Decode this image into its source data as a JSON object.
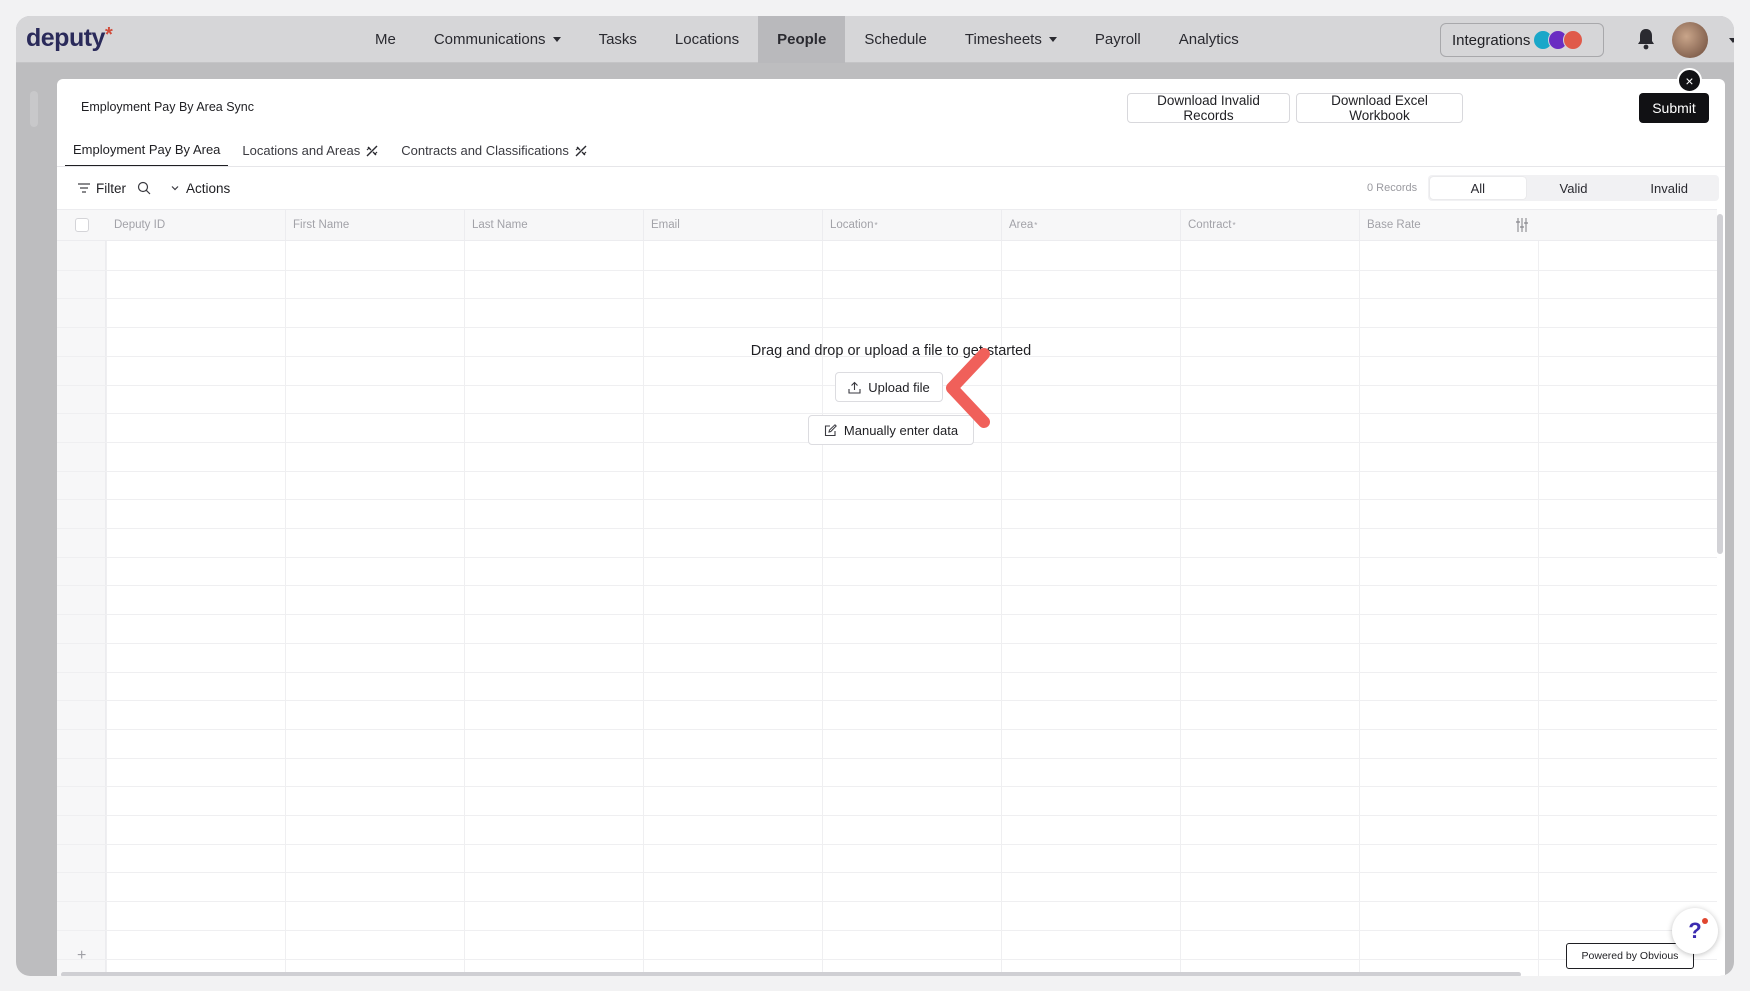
{
  "app": {
    "logo_text": "deputy",
    "logo_star": "*"
  },
  "nav": {
    "items": [
      {
        "label": "Me",
        "active": false,
        "caret": false
      },
      {
        "label": "Communications",
        "active": false,
        "caret": true
      },
      {
        "label": "Tasks",
        "active": false,
        "caret": false
      },
      {
        "label": "Locations",
        "active": false,
        "caret": false
      },
      {
        "label": "People",
        "active": true,
        "caret": false
      },
      {
        "label": "Schedule",
        "active": false,
        "caret": false
      },
      {
        "label": "Timesheets",
        "active": false,
        "caret": true
      },
      {
        "label": "Payroll",
        "active": false,
        "caret": false
      },
      {
        "label": "Analytics",
        "active": false,
        "caret": false
      }
    ],
    "integrations_label": "Integrations",
    "integration_logo_colors": [
      "#1aa7c9",
      "#6a2ec2",
      "#e05a4a"
    ]
  },
  "modal": {
    "title": "Employment Pay By Area Sync",
    "download_invalid_label": "Download Invalid Records",
    "download_excel_label": "Download Excel Workbook",
    "submit_label": "Submit",
    "close_label": "×",
    "tabs": [
      {
        "label": "Employment Pay By Area",
        "active": true,
        "icon": false
      },
      {
        "label": "Locations and Areas",
        "active": false,
        "icon": true
      },
      {
        "label": "Contracts and Classifications",
        "active": false,
        "icon": true
      }
    ],
    "toolbar": {
      "filter_label": "Filter",
      "actions_label": "Actions",
      "records_label": "0 Records",
      "segments": [
        {
          "label": "All",
          "selected": true
        },
        {
          "label": "Valid",
          "selected": false
        },
        {
          "label": "Invalid",
          "selected": false
        }
      ]
    },
    "columns": [
      {
        "label": "Deputy ID",
        "required": false
      },
      {
        "label": "First Name",
        "required": false
      },
      {
        "label": "Last Name",
        "required": false
      },
      {
        "label": "Email",
        "required": false
      },
      {
        "label": "Location",
        "required": true
      },
      {
        "label": "Area",
        "required": true
      },
      {
        "label": "Contract",
        "required": true
      },
      {
        "label": "Base Rate",
        "required": false
      }
    ],
    "empty_state": {
      "message": "Drag and drop or upload a file to get started",
      "upload_label": "Upload file",
      "manual_label": "Manually enter data"
    },
    "add_row_symbol": "+",
    "powered_by": "Powered by Obvious"
  },
  "help_symbol": "?",
  "colors": {
    "accent_dark": "#111114",
    "pointer": "#f0605a",
    "brand_star": "#d04b3a"
  }
}
